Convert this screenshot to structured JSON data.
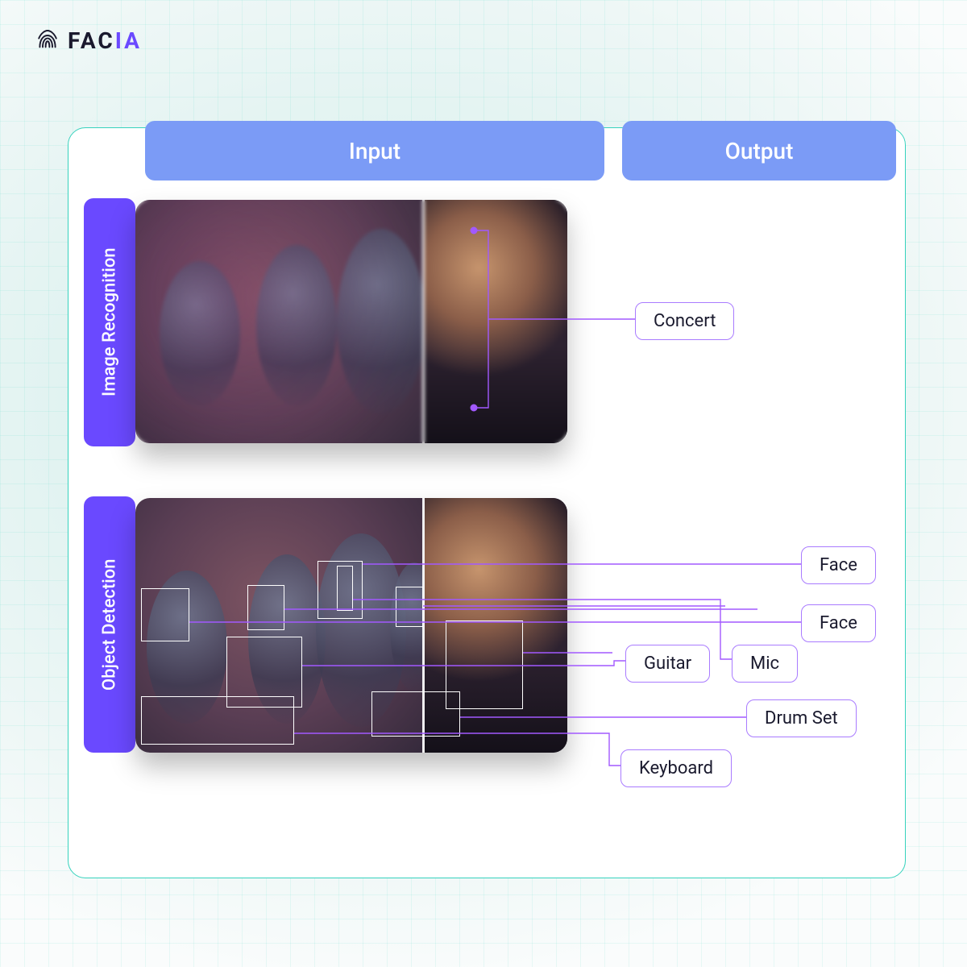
{
  "brand": {
    "name_a": "FAC",
    "name_b": "IA"
  },
  "columns": {
    "input": "Input",
    "output": "Output"
  },
  "rows": {
    "recognition": "Image Recognition",
    "detection": "Object Detection"
  },
  "recognition_output": {
    "label": "Concert"
  },
  "detection_outputs": {
    "face_a": "Face",
    "face_b": "Face",
    "mic": "Mic",
    "guitar": "Guitar",
    "drum_set": "Drum Set",
    "keyboard": "Keyboard"
  }
}
